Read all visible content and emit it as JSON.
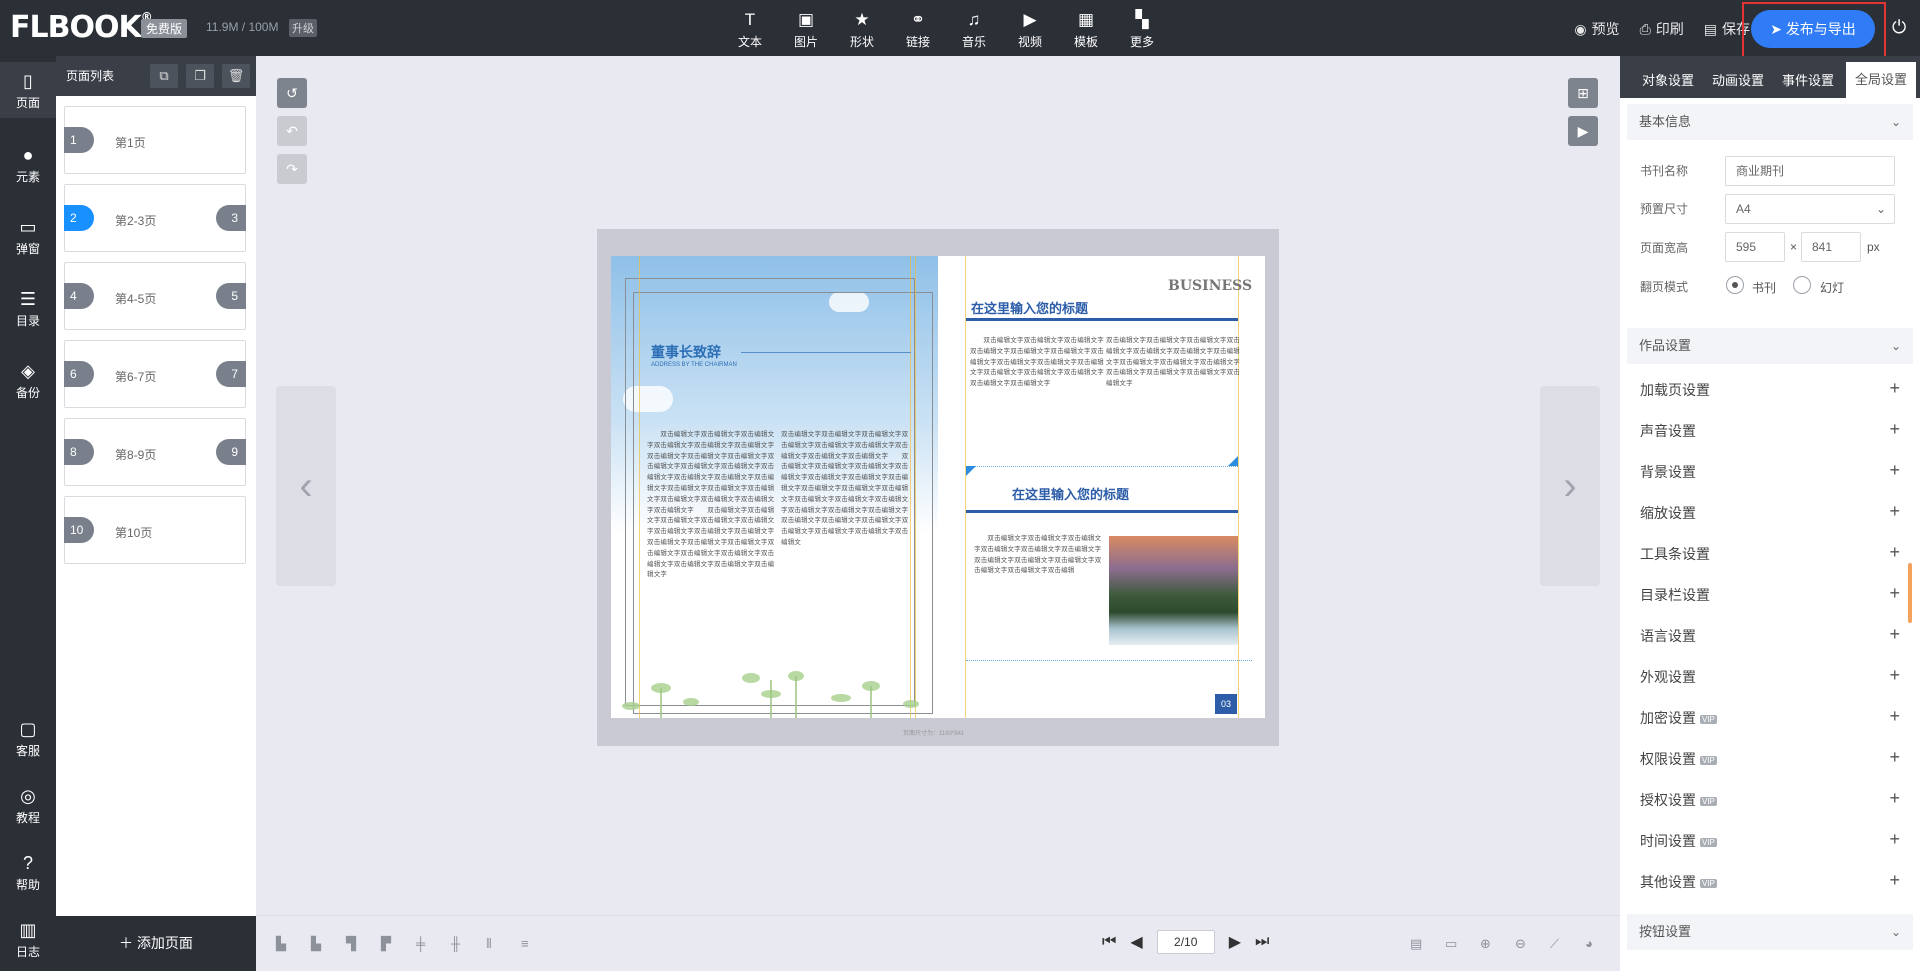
{
  "header": {
    "logo": "FLBOOK",
    "logo_mark": "®",
    "plan_badge": "免费版",
    "quota": "11.9M / 100M",
    "upgrade_label": "升级",
    "tools": [
      {
        "label": "文本",
        "icon": "text-icon"
      },
      {
        "label": "图片",
        "icon": "image-icon"
      },
      {
        "label": "形状",
        "icon": "star-icon"
      },
      {
        "label": "链接",
        "icon": "link-icon"
      },
      {
        "label": "音乐",
        "icon": "music-icon"
      },
      {
        "label": "视频",
        "icon": "video-icon"
      },
      {
        "label": "模板",
        "icon": "template-icon"
      },
      {
        "label": "更多",
        "icon": "more-icon"
      }
    ],
    "preview_label": "预览",
    "print_label": "印刷",
    "save_label": "保存",
    "publish_label": "发布与导出"
  },
  "leftnav": [
    {
      "label": "页面",
      "icon": "page-icon"
    },
    {
      "label": "元素",
      "icon": "elements-icon"
    },
    {
      "label": "弹窗",
      "icon": "popup-icon"
    },
    {
      "label": "目录",
      "icon": "toc-icon"
    },
    {
      "label": "备份",
      "icon": "layers-icon"
    },
    {
      "label": "客服",
      "icon": "chat-icon"
    },
    {
      "label": "教程",
      "icon": "play-icon"
    },
    {
      "label": "帮助",
      "icon": "help-icon"
    },
    {
      "label": "日志",
      "icon": "log-icon"
    }
  ],
  "pagelist": {
    "title": "页面列表",
    "pages": [
      {
        "n1": "1",
        "n2": "",
        "label": "第1页"
      },
      {
        "n1": "2",
        "n2": "3",
        "label": "第2-3页"
      },
      {
        "n1": "4",
        "n2": "5",
        "label": "第4-5页"
      },
      {
        "n1": "6",
        "n2": "7",
        "label": "第6-7页"
      },
      {
        "n1": "8",
        "n2": "9",
        "label": "第8-9页"
      },
      {
        "n1": "10",
        "n2": "",
        "label": "第10页"
      }
    ],
    "add_label": "添加页面"
  },
  "canvas": {
    "left_page": {
      "title": "董事长致辞",
      "subtitle": "ADDRESS BY THE CHAIRMAN",
      "col1": "　　双击编辑文字双击编辑文字双击编辑文字双击编辑文字双击编辑文字双击编辑文字双击编辑文字双击编辑文字双击编辑文字双击编辑文字双击编辑文字双击编辑文字双击编辑文字双击编辑文字双击编辑文字双击编辑文字双击编辑文字双击编辑文字双击编辑文字双击编辑文字双击编辑文字双击编辑文字双击编辑文字　　双击编辑文字双击编辑文字双击编辑文字双击编辑文字双击编辑文字双击编辑文字双击编辑文字双击编辑文字双击编辑文字双击编辑文字双击编辑文字双击编辑文字双击编辑文字双击编辑文字双击编辑文字双击编辑文字双击编辑文字双击编辑文字",
      "col2": "双击编辑文字双击编辑文字双击编辑文字双击编辑文字双击编辑文字双击编辑文字双击编辑文字双击编辑文字双击编辑文字　　双击编辑文字双击编辑文字双击编辑文字双击编辑文字双击编辑文字双击编辑文字双击编辑文字双击编辑文字双击编辑文字双击编辑文字双击编辑文字双击编辑文字双击编辑文字双击编辑文字双击编辑文字双击编辑文字双击编辑文字双击编辑文字双击编辑文字双击编辑文字双击编辑文字双击编辑文字双击编辑文"
    },
    "right_page": {
      "title1": "在这里输入您的标题",
      "title2": "在这里输入您的标题",
      "logo_text": "BUSINESS",
      "col1": "　　双击编辑文字双击编辑文字双击编辑文字双击编辑文字双击编辑文字双击编辑文字双击编辑文字双击编辑文字双击编辑文字双击编辑文字双击编辑文字双击编辑文字双击编辑文字双击编辑文字双击编辑文字",
      "col2": "双击编辑文字双击编辑文字双击编辑文字双击编辑文字双击编辑文字双击编辑文字双击编辑文字双击编辑文字双击编辑文字双击编辑文字双击编辑文字双击编辑文字双击编辑文字双击编辑文字",
      "col3": "　　双击编辑文字双击编辑文字双击编辑文字双击编辑文字双击编辑文字双击编辑文字双击编辑文字双击编辑文字双击编辑文字双击编辑文字双击编辑文字双击编辑",
      "page_number": "03"
    },
    "size_hint": "页面尺寸为：1190*841"
  },
  "pager": {
    "value": "2/10"
  },
  "rightpanel": {
    "tabs": [
      "对象设置",
      "动画设置",
      "事件设置",
      "全局设置"
    ],
    "basic_info": "基本信息",
    "book_name_label": "书刊名称",
    "book_name_value": "商业期刊",
    "preset_size_label": "预置尺寸",
    "preset_size_value": "A4",
    "page_size_label": "页面宽高",
    "width": "595",
    "height": "841",
    "times": "×",
    "unit": "px",
    "flip_mode_label": "翻页模式",
    "mode_book": "书刊",
    "mode_slide": "幻灯",
    "work_settings": "作品设置",
    "settings": [
      {
        "label": "加载页设置",
        "vip": ""
      },
      {
        "label": "声音设置",
        "vip": ""
      },
      {
        "label": "背景设置",
        "vip": ""
      },
      {
        "label": "缩放设置",
        "vip": ""
      },
      {
        "label": "工具条设置",
        "vip": ""
      },
      {
        "label": "目录栏设置",
        "vip": ""
      },
      {
        "label": "语言设置",
        "vip": ""
      },
      {
        "label": "外观设置",
        "vip": ""
      },
      {
        "label": "加密设置",
        "vip": "VIP"
      },
      {
        "label": "权限设置",
        "vip": "VIP"
      },
      {
        "label": "授权设置",
        "vip": "VIP"
      },
      {
        "label": "时间设置",
        "vip": "VIP"
      },
      {
        "label": "其他设置",
        "vip": "VIP"
      }
    ],
    "button_settings": "按钮设置",
    "plus": "+",
    "chevron": "⌄"
  }
}
